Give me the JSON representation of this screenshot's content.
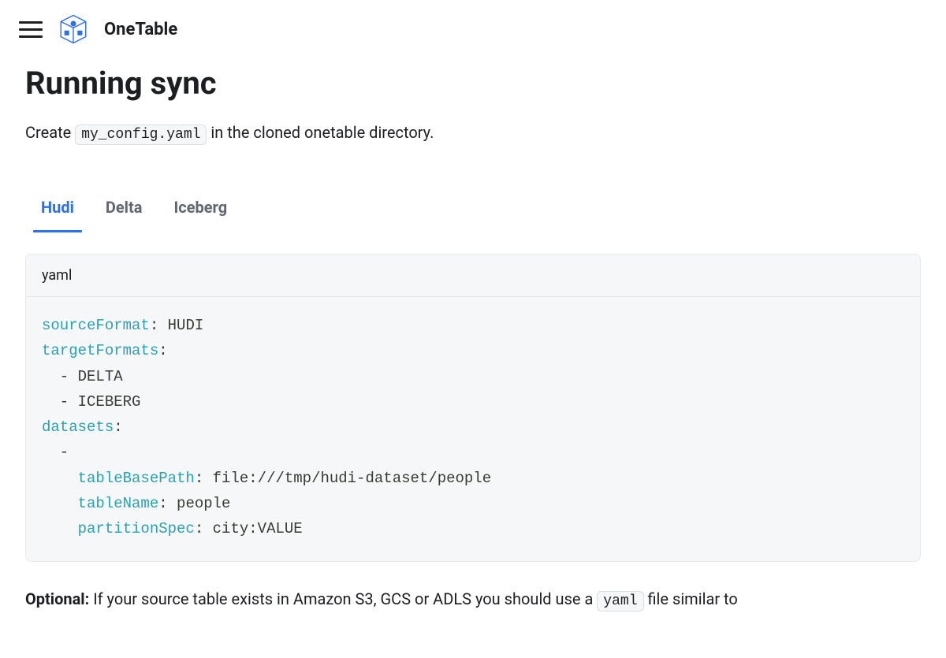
{
  "brand": "OneTable",
  "page_title": "Running sync",
  "intro_prefix": "Create ",
  "intro_code": "my_config.yaml",
  "intro_suffix": " in the cloned onetable directory.",
  "tabs": [
    "Hudi",
    "Delta",
    "Iceberg"
  ],
  "active_tab_index": 0,
  "code_block": {
    "title": "yaml",
    "source_format_key": "sourceFormat",
    "source_format_value": " HUDI",
    "target_formats_key": "targetFormats",
    "target_items": [
      "DELTA",
      "ICEBERG"
    ],
    "datasets_key": "datasets",
    "table_base_path_key": "tableBasePath",
    "table_base_path_value": " file:///tmp/hudi-dataset/people",
    "table_name_key": "tableName",
    "table_name_value": " people",
    "partition_spec_key": "partitionSpec",
    "partition_spec_value": " city:VALUE"
  },
  "optional_label": "Optional:",
  "optional_text_prefix": " If your source table exists in Amazon S3, GCS or ADLS you should use a ",
  "optional_code": "yaml",
  "optional_text_suffix": " file similar to"
}
